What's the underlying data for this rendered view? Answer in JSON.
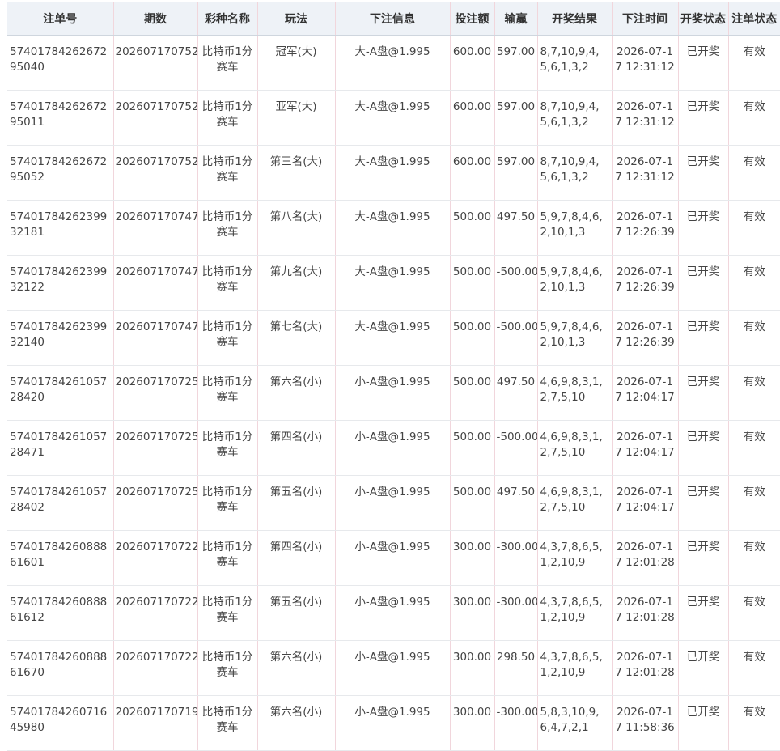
{
  "table": {
    "headers": [
      "注单号",
      "期数",
      "彩种名称",
      "玩法",
      "下注信息",
      "投注额",
      "输赢",
      "开奖结果",
      "下注时间",
      "开奖状态",
      "注单状态"
    ],
    "rows": [
      {
        "order_no": "5740178426267295040",
        "period": "202607170752",
        "lottery": "比特币1分赛车",
        "play": "冠军(大)",
        "bet_info": "大-A盘@1.995",
        "amount": "600.00",
        "win_loss": "597.00",
        "result": "8,7,10,9,4,5,6,1,3,2",
        "time": "2026-07-17 12:31:12",
        "draw_status": "已开奖",
        "order_status": "有效"
      },
      {
        "order_no": "5740178426267295011",
        "period": "202607170752",
        "lottery": "比特币1分赛车",
        "play": "亚军(大)",
        "bet_info": "大-A盘@1.995",
        "amount": "600.00",
        "win_loss": "597.00",
        "result": "8,7,10,9,4,5,6,1,3,2",
        "time": "2026-07-17 12:31:12",
        "draw_status": "已开奖",
        "order_status": "有效"
      },
      {
        "order_no": "5740178426267295052",
        "period": "202607170752",
        "lottery": "比特币1分赛车",
        "play": "第三名(大)",
        "bet_info": "大-A盘@1.995",
        "amount": "600.00",
        "win_loss": "597.00",
        "result": "8,7,10,9,4,5,6,1,3,2",
        "time": "2026-07-17 12:31:12",
        "draw_status": "已开奖",
        "order_status": "有效"
      },
      {
        "order_no": "5740178426239932181",
        "period": "202607170747",
        "lottery": "比特币1分赛车",
        "play": "第八名(大)",
        "bet_info": "大-A盘@1.995",
        "amount": "500.00",
        "win_loss": "497.50",
        "result": "5,9,7,8,4,6,2,10,1,3",
        "time": "2026-07-17 12:26:39",
        "draw_status": "已开奖",
        "order_status": "有效"
      },
      {
        "order_no": "5740178426239932122",
        "period": "202607170747",
        "lottery": "比特币1分赛车",
        "play": "第九名(大)",
        "bet_info": "大-A盘@1.995",
        "amount": "500.00",
        "win_loss": "-500.00",
        "result": "5,9,7,8,4,6,2,10,1,3",
        "time": "2026-07-17 12:26:39",
        "draw_status": "已开奖",
        "order_status": "有效"
      },
      {
        "order_no": "5740178426239932140",
        "period": "202607170747",
        "lottery": "比特币1分赛车",
        "play": "第七名(大)",
        "bet_info": "大-A盘@1.995",
        "amount": "500.00",
        "win_loss": "-500.00",
        "result": "5,9,7,8,4,6,2,10,1,3",
        "time": "2026-07-17 12:26:39",
        "draw_status": "已开奖",
        "order_status": "有效"
      },
      {
        "order_no": "5740178426105728420",
        "period": "202607170725",
        "lottery": "比特币1分赛车",
        "play": "第六名(小)",
        "bet_info": "小-A盘@1.995",
        "amount": "500.00",
        "win_loss": "497.50",
        "result": "4,6,9,8,3,1,2,7,5,10",
        "time": "2026-07-17 12:04:17",
        "draw_status": "已开奖",
        "order_status": "有效"
      },
      {
        "order_no": "5740178426105728471",
        "period": "202607170725",
        "lottery": "比特币1分赛车",
        "play": "第四名(小)",
        "bet_info": "小-A盘@1.995",
        "amount": "500.00",
        "win_loss": "-500.00",
        "result": "4,6,9,8,3,1,2,7,5,10",
        "time": "2026-07-17 12:04:17",
        "draw_status": "已开奖",
        "order_status": "有效"
      },
      {
        "order_no": "5740178426105728402",
        "period": "202607170725",
        "lottery": "比特币1分赛车",
        "play": "第五名(小)",
        "bet_info": "小-A盘@1.995",
        "amount": "500.00",
        "win_loss": "497.50",
        "result": "4,6,9,8,3,1,2,7,5,10",
        "time": "2026-07-17 12:04:17",
        "draw_status": "已开奖",
        "order_status": "有效"
      },
      {
        "order_no": "5740178426088861601",
        "period": "202607170722",
        "lottery": "比特币1分赛车",
        "play": "第四名(小)",
        "bet_info": "小-A盘@1.995",
        "amount": "300.00",
        "win_loss": "-300.00",
        "result": "4,3,7,8,6,5,1,2,10,9",
        "time": "2026-07-17 12:01:28",
        "draw_status": "已开奖",
        "order_status": "有效"
      },
      {
        "order_no": "5740178426088861612",
        "period": "202607170722",
        "lottery": "比特币1分赛车",
        "play": "第五名(小)",
        "bet_info": "小-A盘@1.995",
        "amount": "300.00",
        "win_loss": "-300.00",
        "result": "4,3,7,8,6,5,1,2,10,9",
        "time": "2026-07-17 12:01:28",
        "draw_status": "已开奖",
        "order_status": "有效"
      },
      {
        "order_no": "5740178426088861670",
        "period": "202607170722",
        "lottery": "比特币1分赛车",
        "play": "第六名(小)",
        "bet_info": "小-A盘@1.995",
        "amount": "300.00",
        "win_loss": "298.50",
        "result": "4,3,7,8,6,5,1,2,10,9",
        "time": "2026-07-17 12:01:28",
        "draw_status": "已开奖",
        "order_status": "有效"
      },
      {
        "order_no": "5740178426071645980",
        "period": "202607170719",
        "lottery": "比特币1分赛车",
        "play": "第六名(小)",
        "bet_info": "小-A盘@1.995",
        "amount": "300.00",
        "win_loss": "-300.00",
        "result": "5,8,3,10,9,6,4,7,2,1",
        "time": "2026-07-17 11:58:36",
        "draw_status": "已开奖",
        "order_status": "有效"
      }
    ]
  }
}
